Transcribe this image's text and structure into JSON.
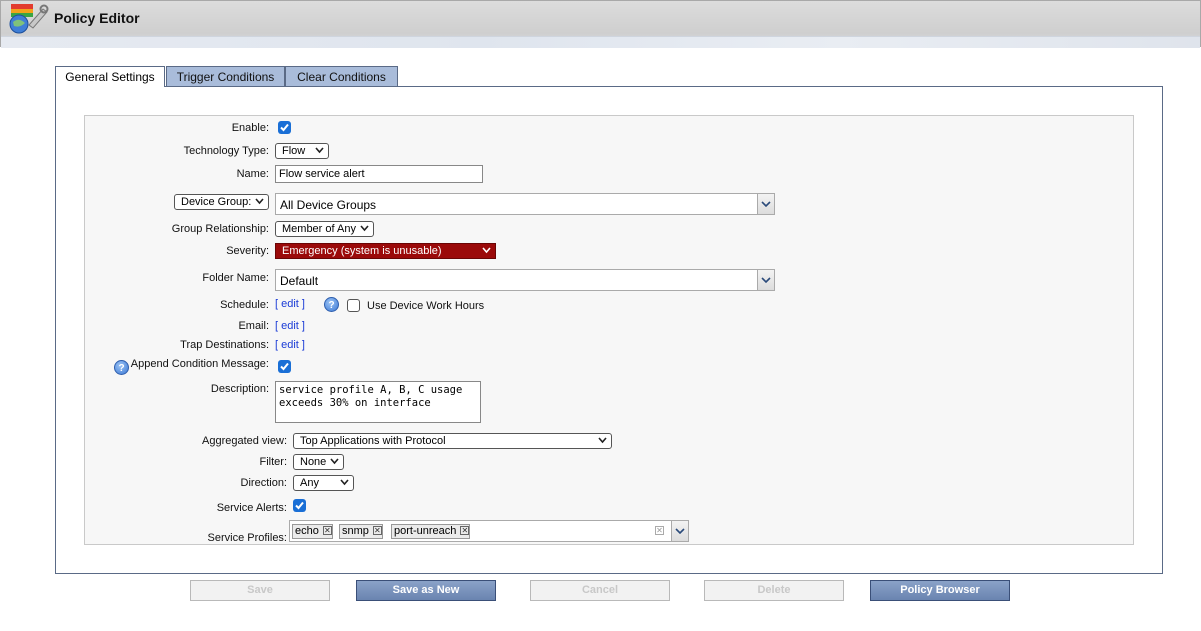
{
  "app": {
    "title": "Policy Editor"
  },
  "tabs": [
    {
      "label": "General Settings",
      "active": true
    },
    {
      "label": "Trigger Conditions",
      "active": false
    },
    {
      "label": "Clear Conditions",
      "active": false
    }
  ],
  "form": {
    "enable": {
      "label": "Enable:",
      "checked": true
    },
    "technology_type": {
      "label": "Technology Type:",
      "value": "Flow"
    },
    "name": {
      "label": "Name:",
      "value": "Flow service alert"
    },
    "device_group": {
      "label": "Device Group:",
      "value": "All Device Groups"
    },
    "group_relationship": {
      "label": "Group Relationship:",
      "value": "Member of Any"
    },
    "severity": {
      "label": "Severity:",
      "value": "Emergency (system is unusable)",
      "color": "#9b0a0a"
    },
    "folder_name": {
      "label": "Folder Name:",
      "value": "Default"
    },
    "schedule": {
      "label": "Schedule:",
      "link": "[ edit ]",
      "work_hours_label": "Use Device Work Hours",
      "work_hours_checked": false
    },
    "email": {
      "label": "Email:",
      "link": "[ edit ]"
    },
    "trap_destinations": {
      "label": "Trap Destinations:",
      "link": "[ edit ]"
    },
    "append_condition_message": {
      "label": "Append Condition Message:",
      "checked": true
    },
    "description": {
      "label": "Description:",
      "line1": "service profile A, B, C usage",
      "line2": "exceeds 30% on interface"
    },
    "aggregated_view": {
      "label": "Aggregated view:",
      "value": "Top Applications with Protocol"
    },
    "filter": {
      "label": "Filter:",
      "value": "None"
    },
    "direction": {
      "label": "Direction:",
      "value": "Any"
    },
    "service_alerts": {
      "label": "Service Alerts:",
      "checked": true
    },
    "service_profiles": {
      "label": "Service Profiles:",
      "tags": [
        "echo",
        "snmp",
        "port-unreach"
      ]
    }
  },
  "buttons": {
    "save": "Save",
    "save_as_new": "Save as New",
    "cancel": "Cancel",
    "delete": "Delete",
    "policy_browser": "Policy Browser"
  },
  "icons": {
    "app": "policy-editor-icon",
    "help": "help-icon",
    "caret": "chevron-down-icon",
    "check": "checkmark-icon",
    "remove": "close-icon"
  }
}
